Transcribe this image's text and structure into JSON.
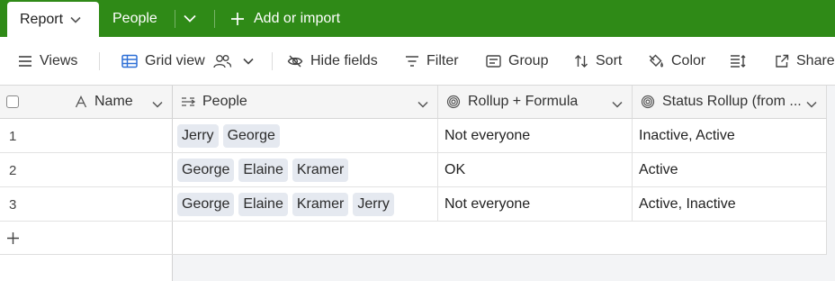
{
  "tabs": {
    "active": "Report",
    "second": "People",
    "add": "Add or import"
  },
  "toolbar": {
    "views": "Views",
    "grid_view": "Grid view",
    "hide_fields": "Hide fields",
    "filter": "Filter",
    "group": "Group",
    "sort": "Sort",
    "color": "Color",
    "share": "Share"
  },
  "columns": {
    "name": "Name",
    "people": "People",
    "rollup_formula": "Rollup + Formula",
    "status_rollup": "Status Rollup (from ..."
  },
  "rows": [
    {
      "num": "1",
      "people": [
        "Jerry",
        "George"
      ],
      "rollup_formula": "Not everyone",
      "status_rollup": "Inactive, Active"
    },
    {
      "num": "2",
      "people": [
        "George",
        "Elaine",
        "Kramer"
      ],
      "rollup_formula": "OK",
      "status_rollup": "Active"
    },
    {
      "num": "3",
      "people": [
        "George",
        "Elaine",
        "Kramer",
        "Jerry"
      ],
      "rollup_formula": "Not everyone",
      "status_rollup": "Active, Inactive"
    }
  ],
  "colors": {
    "brand_green": "#2f8a17",
    "chip_bg": "#e5e9f0",
    "grid_view_icon": "#2d6fd6"
  }
}
